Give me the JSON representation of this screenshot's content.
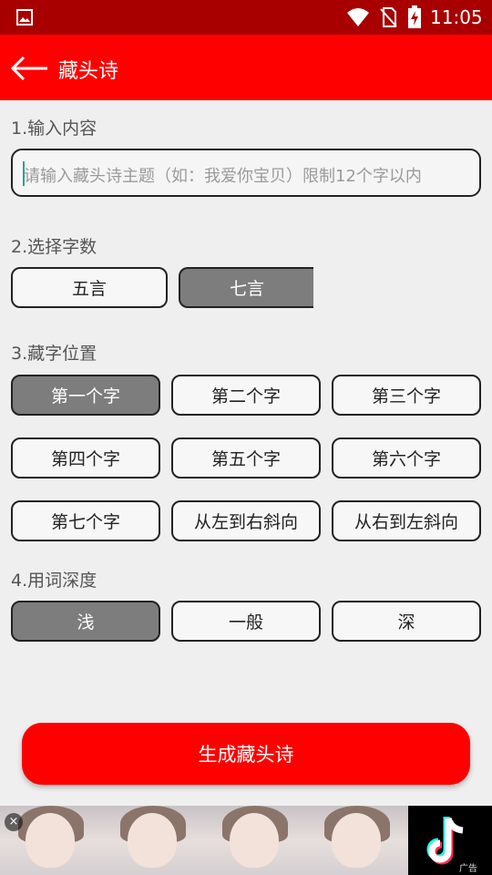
{
  "status_bar": {
    "time": "11:05",
    "icons": [
      "picture-icon",
      "wifi-icon",
      "no-sim-icon",
      "battery-charging-icon"
    ]
  },
  "app_bar": {
    "title": "藏头诗",
    "back_icon": "back-arrow-icon"
  },
  "section1": {
    "label": "1.输入内容",
    "input_value": "",
    "placeholder": "请输入藏头诗主题（如：我爱你宝贝）限制12个字以内"
  },
  "section2": {
    "label": "2.选择字数",
    "options": [
      "五言",
      "七言"
    ],
    "selected": "七言"
  },
  "section3": {
    "label": "3.藏字位置",
    "options": [
      "第一个字",
      "第二个字",
      "第三个字",
      "第四个字",
      "第五个字",
      "第六个字",
      "第七个字",
      "从左到右斜向",
      "从右到左斜向"
    ],
    "selected": "第一个字"
  },
  "section4": {
    "label": "4.用词深度",
    "options": [
      "浅",
      "一般",
      "深"
    ],
    "selected": "浅"
  },
  "generate_button": "生成藏头诗",
  "ad": {
    "close": "×",
    "tag": "广告",
    "logo_icon": "tiktok-logo-icon"
  },
  "colors": {
    "status_bar": "#a80000",
    "app_bar": "#ff0000",
    "selected_option": "#7d7d7d",
    "background": "#efefef"
  }
}
